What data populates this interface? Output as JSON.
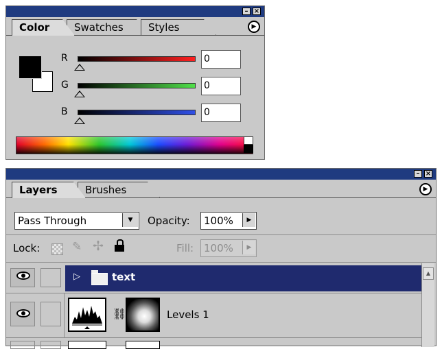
{
  "color_panel": {
    "tabs": [
      "Color",
      "Swatches",
      "Styles"
    ],
    "channels": [
      {
        "label": "R",
        "value": "0",
        "color_end": "#ff2020"
      },
      {
        "label": "G",
        "value": "0",
        "color_end": "#50e04a"
      },
      {
        "label": "B",
        "value": "0",
        "color_end": "#3050e8"
      }
    ],
    "colors": {
      "titlebar": "#1f3b80",
      "foreground": "#000000",
      "background": "#ffffff"
    }
  },
  "layers_panel": {
    "tabs": [
      "Layers",
      "Brushes"
    ],
    "blend_mode": "Pass Through",
    "opacity_label": "Opacity:",
    "opacity_value": "100%",
    "lock_label": "Lock:",
    "fill_label": "Fill:",
    "fill_value": "100%",
    "layers": [
      {
        "name": "text",
        "type": "group",
        "selected": true
      },
      {
        "name": "Levels 1",
        "type": "adjustment",
        "selected": false
      }
    ]
  },
  "icons": [
    "minimize-icon",
    "close-icon",
    "panel-menu-icon",
    "eye-icon",
    "folder-icon",
    "disclosure-triangle-icon",
    "link-icon",
    "lock-transparency-icon",
    "lock-paint-icon",
    "lock-move-icon",
    "lock-all-icon",
    "scroll-up-icon"
  ]
}
